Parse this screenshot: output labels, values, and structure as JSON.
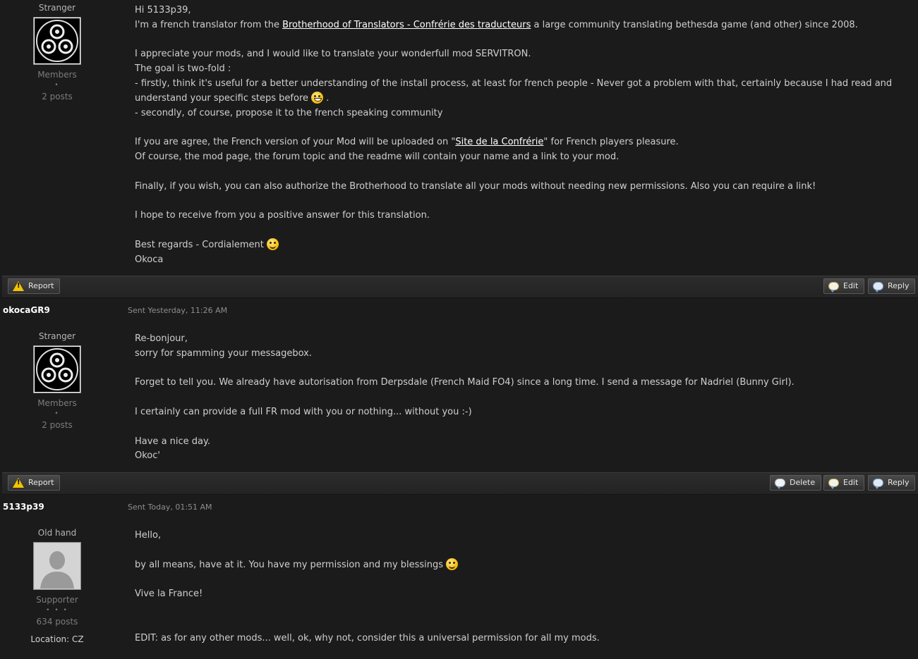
{
  "posts": [
    {
      "author": {
        "rank": "Stranger",
        "avatar": "triskelion-avatar",
        "group": "Members",
        "pips": "•",
        "posts": "2 posts"
      },
      "body": {
        "l1": "Hi 5133p39,",
        "l2_pre": "I'm a french translator from the ",
        "l2_link": "Brotherhood of Translators - Confrérie des traducteurs",
        "l2_post": " a large community translating bethesda game (and other) since 2008.",
        "l3": "I appreciate your mods, and I would like to translate your wonderfull mod SERVITRON.",
        "l4": "The goal is two-fold :",
        "l5": "- firstly, think it's useful for a better understanding of the install process, at least for french people - Never got a problem with that, certainly because I had read and",
        "l6_pre": "understand your specific steps before ",
        "l6_post": " .",
        "l7": "- secondly, of course, propose it to the french speaking community",
        "l8_pre": "If you are agree, the French version of your Mod will be uploaded on \"",
        "l8_link": "Site de la Confrérie",
        "l8_post": "\" for French players pleasure.",
        "l9": "Of course, the mod page, the forum topic and the readme will contain your name and a link to your mod.",
        "l10": "Finally, if you wish, you can also authorize the Brotherhood to translate all your mods without needing new permissions. Also you can require a link!",
        "l11": "I hope to receive from you a positive answer for this translation.",
        "l12": "Best regards - Cordialement ",
        "l13": "Okoca"
      }
    },
    {
      "username": "okocaGR9",
      "sent": "Sent Yesterday, 11:26 AM",
      "author": {
        "rank": "Stranger",
        "avatar": "triskelion-avatar",
        "group": "Members",
        "pips": "•",
        "posts": "2 posts"
      },
      "body": {
        "l1": "Re-bonjour,",
        "l2": "sorry for spamming your messagebox.",
        "l3": "Forget to tell you. We already have autorisation from Derpsdale (French Maid FO4) since a long time. I send a message for Nadriel (Bunny Girl).",
        "l4": "I certainly can provide a full FR mod with you or nothing... without you :-)",
        "l5": "Have a nice day.",
        "l6": "Okoc'"
      }
    },
    {
      "username": "5133p39",
      "sent": "Sent Today, 01:51 AM",
      "author": {
        "rank": "Old hand",
        "avatar": "default-user-avatar",
        "group": "Supporter",
        "pips": "• • •",
        "posts": "634 posts",
        "location": "Location: CZ"
      },
      "body": {
        "l1": "Hello,",
        "l2": "by all means, have at it. You have my permission and my blessings ",
        "l3": "Vive la France!",
        "l4": "EDIT: as for any other mods... well, ok, why not, consider this a universal permission for all my mods."
      }
    }
  ],
  "actions": {
    "report": "Report",
    "delete": "Delete",
    "edit": "Edit",
    "reply": "Reply"
  },
  "icons": {
    "report": "warning-icon",
    "delete": "speech-bubble-icon",
    "edit": "edit-bubble-icon",
    "reply": "speech-bubble-icon",
    "emoji_grin": "grin-emoji",
    "emoji_smile": "smile-emoji"
  }
}
